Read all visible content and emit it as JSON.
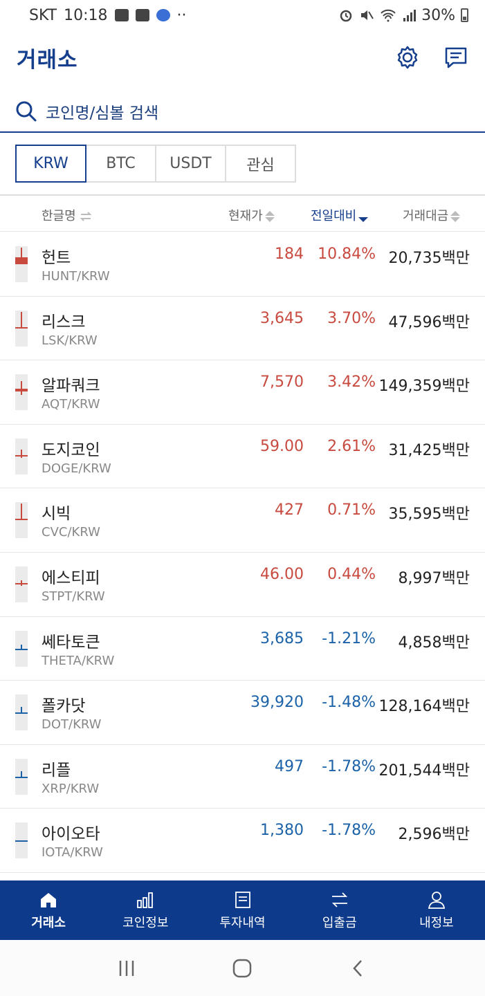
{
  "status_bar": {
    "carrier": "SKT",
    "time": "10:18",
    "battery": "30%"
  },
  "header": {
    "title": "거래소",
    "settings_icon": "gear-icon",
    "chat_icon": "chat-icon"
  },
  "search": {
    "placeholder": "코인명/심볼 검색",
    "icon": "search-icon"
  },
  "market_tabs": [
    {
      "label": "KRW",
      "active": true
    },
    {
      "label": "BTC",
      "active": false
    },
    {
      "label": "USDT",
      "active": false
    },
    {
      "label": "관심",
      "active": false
    }
  ],
  "columns": {
    "name": "한글명",
    "price": "현재가",
    "change": "전일대비",
    "volume": "거래대금"
  },
  "coins": [
    {
      "name": "헌트",
      "symbol": "HUNT/KRW",
      "price": "184",
      "change": "10.84%",
      "volume": "20,735백만",
      "direction": "up"
    },
    {
      "name": "리스크",
      "symbol": "LSK/KRW",
      "price": "3,645",
      "change": "3.70%",
      "volume": "47,596백만",
      "direction": "up"
    },
    {
      "name": "알파쿼크",
      "symbol": "AQT/KRW",
      "price": "7,570",
      "change": "3.42%",
      "volume": "149,359백만",
      "direction": "up"
    },
    {
      "name": "도지코인",
      "symbol": "DOGE/KRW",
      "price": "59.00",
      "change": "2.61%",
      "volume": "31,425백만",
      "direction": "up"
    },
    {
      "name": "시빅",
      "symbol": "CVC/KRW",
      "price": "427",
      "change": "0.71%",
      "volume": "35,595백만",
      "direction": "up"
    },
    {
      "name": "에스티피",
      "symbol": "STPT/KRW",
      "price": "46.00",
      "change": "0.44%",
      "volume": "8,997백만",
      "direction": "up"
    },
    {
      "name": "쎄타토큰",
      "symbol": "THETA/KRW",
      "price": "3,685",
      "change": "-1.21%",
      "volume": "4,858백만",
      "direction": "down"
    },
    {
      "name": "폴카닷",
      "symbol": "DOT/KRW",
      "price": "39,920",
      "change": "-1.48%",
      "volume": "128,164백만",
      "direction": "down"
    },
    {
      "name": "리플",
      "symbol": "XRP/KRW",
      "price": "497",
      "change": "-1.78%",
      "volume": "201,544백만",
      "direction": "down"
    },
    {
      "name": "아이오타",
      "symbol": "IOTA/KRW",
      "price": "1,380",
      "change": "-1.78%",
      "volume": "2,596백만",
      "direction": "down"
    }
  ],
  "bottom_nav": [
    {
      "label": "거래소",
      "icon": "home-icon",
      "active": true
    },
    {
      "label": "코인정보",
      "icon": "bar-chart-icon",
      "active": false
    },
    {
      "label": "투자내역",
      "icon": "document-icon",
      "active": false
    },
    {
      "label": "입출금",
      "icon": "transfer-icon",
      "active": false
    },
    {
      "label": "내정보",
      "icon": "user-icon",
      "active": false
    }
  ],
  "colors": {
    "brand": "#0d3a8a",
    "up": "#c84a3f",
    "down": "#1b62a8"
  }
}
